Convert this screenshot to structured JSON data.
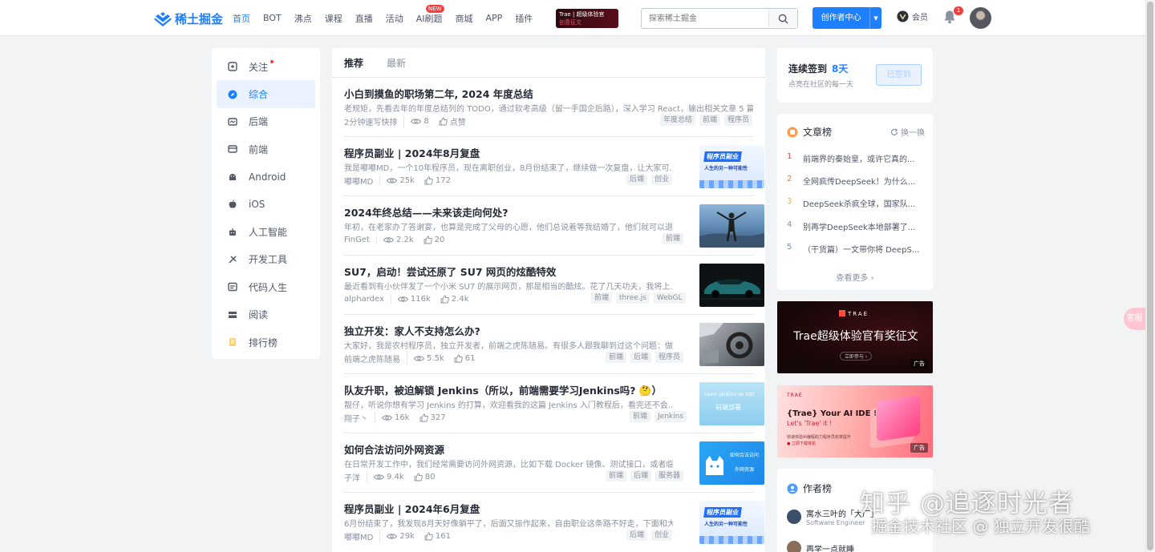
{
  "header": {
    "logo": "稀土掘金",
    "nav": [
      {
        "label": "首页",
        "active": true
      },
      {
        "label": "BOT"
      },
      {
        "label": "沸点"
      },
      {
        "label": "课程"
      },
      {
        "label": "直播"
      },
      {
        "label": "活动"
      },
      {
        "label": "AI刷题",
        "badge": "NEW"
      },
      {
        "label": "商城"
      },
      {
        "label": "APP"
      },
      {
        "label": "插件"
      }
    ],
    "promo": {
      "line1": "Trae | 超级体验官",
      "line2": "创意征文"
    },
    "search_placeholder": "探索稀土掘金",
    "creator_button": "创作者中心",
    "vip_label": "会员",
    "notification_count": "1"
  },
  "sidebar": {
    "items": [
      {
        "label": "关注",
        "icon": "follow-icon"
      },
      {
        "label": "综合",
        "icon": "compass-icon",
        "active": true
      },
      {
        "label": "后端",
        "icon": "backend-icon"
      },
      {
        "label": "前端",
        "icon": "frontend-icon"
      },
      {
        "label": "Android",
        "icon": "android-icon"
      },
      {
        "label": "iOS",
        "icon": "apple-icon"
      },
      {
        "label": "人工智能",
        "icon": "robot-icon"
      },
      {
        "label": "开发工具",
        "icon": "tools-icon"
      },
      {
        "label": "代码人生",
        "icon": "code-life-icon"
      },
      {
        "label": "阅读",
        "icon": "book-icon"
      },
      {
        "label": "排行榜",
        "icon": "trophy-icon"
      }
    ]
  },
  "feed": {
    "tabs": [
      "推荐",
      "最新"
    ],
    "articles": [
      {
        "title": "小白到摸鱼的职场第二年, 2024 年度总结",
        "abstract": "老规矩，先看去年的年度总结列的 TODO，通过软考高级（留一手国企后路），深入学习 React，输出相关文章 5 篇...",
        "author": "2分钟速写快排",
        "views": "8",
        "likes": "点赞",
        "tags": [
          "年度总结",
          "前端",
          "程序员"
        ]
      },
      {
        "title": "程序员副业 | 2024年8月复盘",
        "abstract": "我是嘟嘟MD，一个10年程序员，现在离职创业，8月份结束了，继续做一次复盘，让大家可...",
        "author": "嘟嘟MD",
        "views": "25k",
        "likes": "172",
        "tags": [
          "后端",
          "创业"
        ],
        "thumb_text": [
          "程序员副业",
          "人生的另一种可能性"
        ]
      },
      {
        "title": "2024年终总结——未来该走向何处?",
        "abstract": "年初，在老家办了答谢宴，也算是完成了父母的心愿，他们总说着等我结婚了，他们就可以退...",
        "author": "FinGet",
        "views": "2.2k",
        "likes": "20",
        "tags": [
          "前端"
        ]
      },
      {
        "title": "SU7，启动！尝试还原了 SU7 网页的炫酷特效",
        "abstract": "最近看到有小伙伴发了一个小米 SU7 的展示网页，那是相当的酷炫。花了几天功夫，我将上...",
        "author": "alphardex",
        "views": "116k",
        "likes": "2.4k",
        "tags": [
          "前端",
          "three.js",
          "WebGL"
        ]
      },
      {
        "title": "独立开发：家人不支持怎么办?",
        "abstract": "大家好，我是农村程序员，独立开发者，前端之虎陈随易。有很多人跟我聊到过这个问题：做...",
        "author": "前端之虎陈随易",
        "views": "5.5k",
        "likes": "61",
        "tags": [
          "前端",
          "后端",
          "程序员"
        ]
      },
      {
        "title": "队友升职，被迫解锁 Jenkins（所以，前端需要学习Jenkins吗? 🤔）",
        "abstract": "靓仔，听说你想有学习 Jenkins 的打算，欢迎看我的这篇 Jenkins 入门教程后，看完还不会...",
        "author": "翔子丶",
        "views": "16k",
        "likes": "327",
        "tags": [
          "前端",
          "Jenkins"
        ],
        "thumb_text": [
          "Learn Jenkins on K8S",
          "前端部署"
        ]
      },
      {
        "title": "如何合法访问外网资源",
        "abstract": "在日常开发工作中，我们经常需要访问外网资源，比如下载 Docker 镜像、测试接口，或者临...",
        "author": "子洋",
        "views": "9.4k",
        "likes": "80",
        "tags": [
          "前端",
          "后端",
          "服务器"
        ],
        "thumb_text": [
          "如何合法访问",
          "外网资源"
        ]
      },
      {
        "title": "程序员副业 | 2024年6月复盘",
        "abstract": "6月份结束了，我发现8月天好像躺平了，后面又振作起来，自由职业这条路不好走，下面和大...",
        "author": "嘟嘟MD",
        "views": "29k",
        "likes": "161",
        "tags": [
          "后端",
          "创业"
        ],
        "thumb_text": [
          "程序员副业",
          "人生的另一种可能性"
        ]
      }
    ]
  },
  "signin": {
    "title": "连续签到",
    "days": "8天",
    "subtitle": "点亮在社区的每一天",
    "button": "已签到"
  },
  "rank": {
    "title": "文章榜",
    "switch_label": "换一换",
    "items": [
      {
        "num": "1",
        "text": "前端界的秦始皇，或许它真的..."
      },
      {
        "num": "2",
        "text": "全网疯传DeepSeek！为什么..."
      },
      {
        "num": "3",
        "text": "DeepSeek杀疯全球，国家队..."
      },
      {
        "num": "4",
        "text": "别再学DeepSeek本地部署了..."
      },
      {
        "num": "5",
        "text": "（干货篇）一文带你将 DeepS..."
      }
    ],
    "more": "查看更多 ›"
  },
  "ads": {
    "ad1": {
      "brand": "TRAE",
      "text": "Trae超级体验官有奖征文",
      "cta": "立即参与 ›",
      "tag": "广告"
    },
    "ad2": {
      "brand": "TRAE",
      "line1": "{Trae} Your AI IDE !",
      "line2": "Let's 'Trae' it !",
      "line3": "快速体验AI编程助力程序员效率提升",
      "line4": "● 立即下载体验",
      "tag": "广告"
    }
  },
  "authors": {
    "title": "作者榜",
    "items": [
      {
        "name": "寓水三叶的「大厂」",
        "desc": "Software Engineer"
      },
      {
        "name": "再学一点就睡",
        "desc": ""
      }
    ]
  },
  "watermark": {
    "line1": "知乎 @追逐时光者",
    "line2": "掘金技术社区 @ 独立开发很酷"
  },
  "float_label": "客服"
}
